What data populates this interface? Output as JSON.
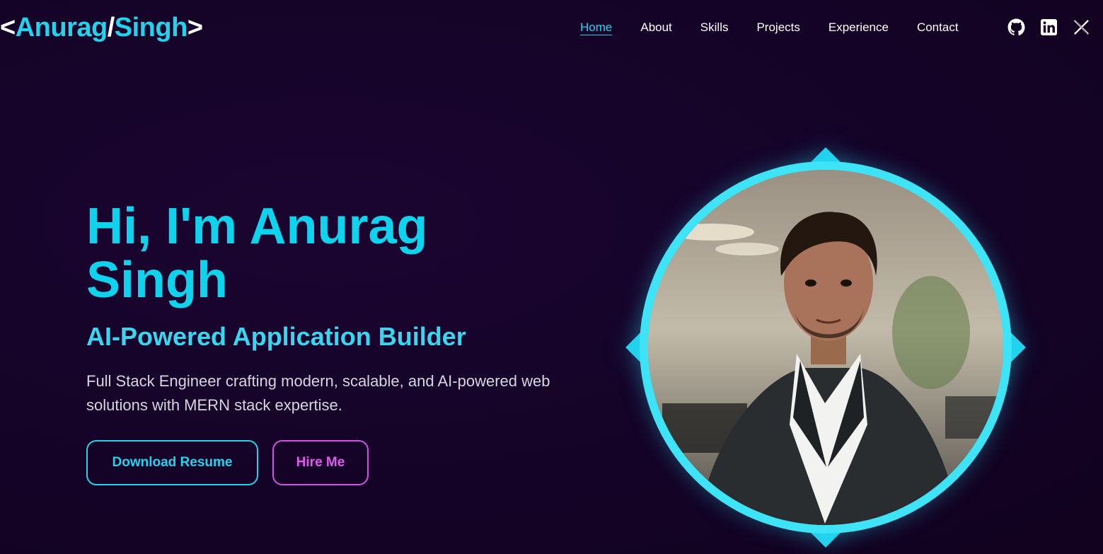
{
  "logo": {
    "open": "<",
    "first": "Anurag",
    "slash": "/",
    "last": "Singh",
    "close": ">"
  },
  "nav": {
    "items": [
      {
        "label": "Home",
        "active": true
      },
      {
        "label": "About",
        "active": false
      },
      {
        "label": "Skills",
        "active": false
      },
      {
        "label": "Projects",
        "active": false
      },
      {
        "label": "Experience",
        "active": false
      },
      {
        "label": "Contact",
        "active": false
      }
    ]
  },
  "socials": [
    "github-icon",
    "linkedin-icon",
    "x-icon"
  ],
  "hero": {
    "title": "Hi, I'm Anurag Singh",
    "subtitle": "AI-Powered Application Builder",
    "description": "Full Stack Engineer crafting modern, scalable, and AI-powered web solutions with MERN stack expertise.",
    "resume_button": "Download Resume",
    "hire_button": "Hire Me"
  },
  "colors": {
    "background": "#140326",
    "accent_cyan": "#22d3ee",
    "accent_pink": "#e05af0"
  }
}
